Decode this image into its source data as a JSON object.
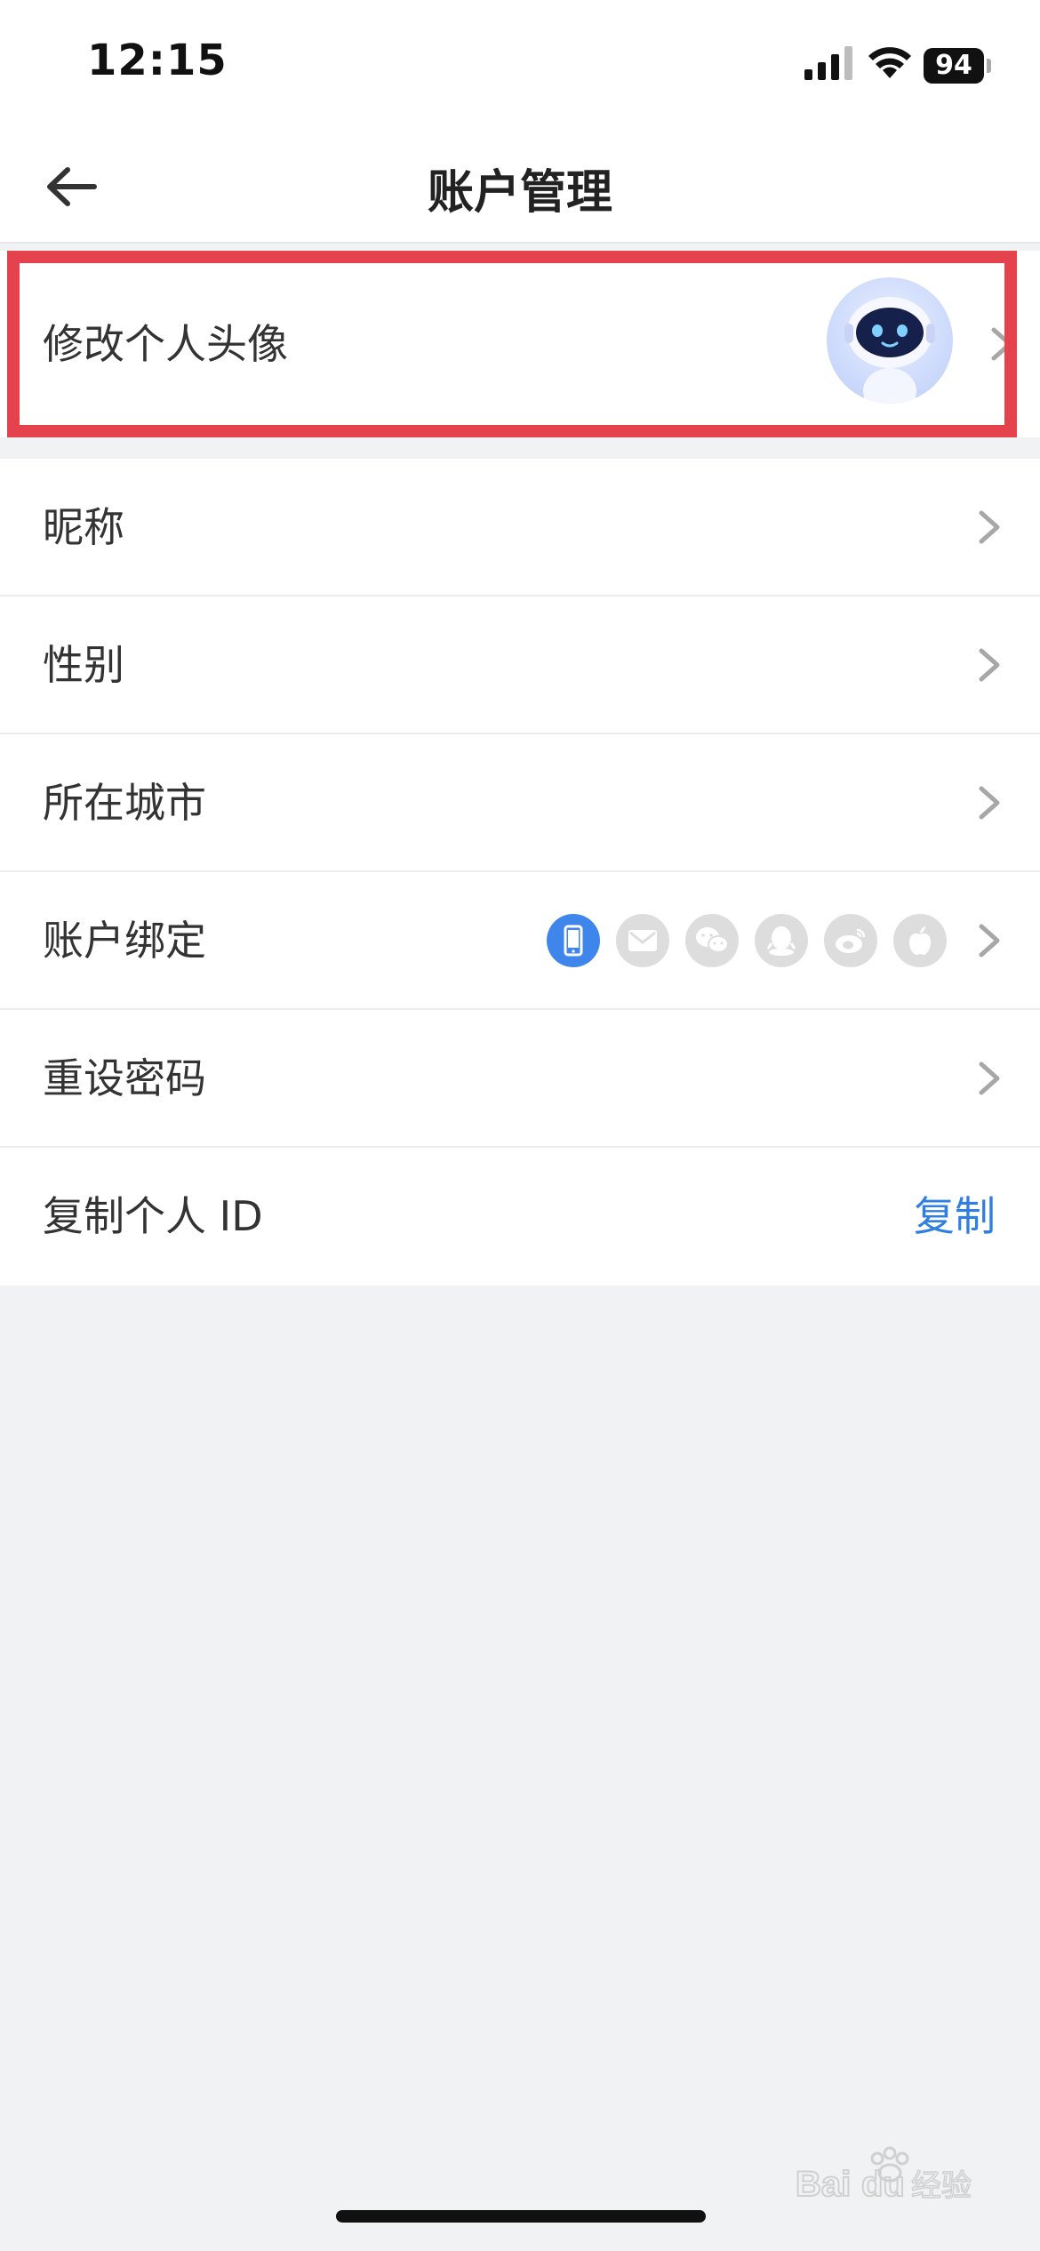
{
  "status_bar": {
    "time": "12:15",
    "battery": "94"
  },
  "header": {
    "title": "账户管理"
  },
  "rows": {
    "avatar": {
      "label": "修改个人头像"
    },
    "nickname": {
      "label": "昵称"
    },
    "gender": {
      "label": "性别"
    },
    "city": {
      "label": "所在城市"
    },
    "binding": {
      "label": "账户绑定",
      "icons": [
        "phone-icon",
        "email-icon",
        "wechat-icon",
        "qq-icon",
        "weibo-icon",
        "apple-icon"
      ],
      "active_icon": "phone-icon"
    },
    "reset_password": {
      "label": "重设密码"
    },
    "copy_id": {
      "label": "复制个人 ID",
      "action": "复制"
    }
  },
  "colors": {
    "highlight": "#e4424d",
    "accent": "#2f7fe3",
    "active_icon_bg": "#3e86ec",
    "inactive_icon_bg": "#dddddd"
  }
}
